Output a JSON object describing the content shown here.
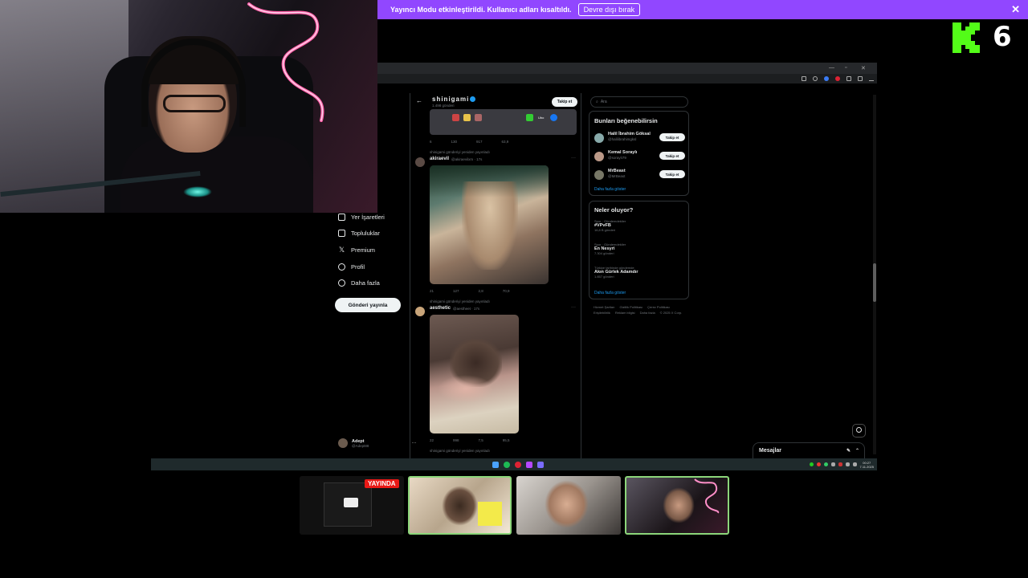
{
  "banner": {
    "message": "Yayıncı Modu etkinleştirildi. Kullanıcı adları kısaltıldı.",
    "button": "Devre dışı bırak",
    "close": "✕"
  },
  "kick": {
    "count": "6"
  },
  "left_nav": {
    "items": [
      {
        "label": "Yer İşaretleri",
        "icon": "bookmark-icon"
      },
      {
        "label": "Topluluklar",
        "icon": "communities-icon"
      },
      {
        "label": "Premium",
        "icon": "x-logo-icon"
      },
      {
        "label": "Profil",
        "icon": "profile-icon"
      },
      {
        "label": "Daha fazla",
        "icon": "more-icon"
      }
    ],
    "post_button": "Gönderi yayınla",
    "account_name": "Adept",
    "account_handle": "@Adept88"
  },
  "profile_header": {
    "name": "shinigami",
    "sub": "1.498 gönderi",
    "follow": "Takip et"
  },
  "feed": {
    "posts": [
      {
        "retweet_label": "shinigami gönderiyi yeniden yayınladı",
        "name": "akiraevil",
        "handle": "@akiraevilxm · 17s",
        "actions": [
          "21",
          "127",
          "2,8",
          "70,9"
        ]
      },
      {
        "retweet_label": "shinigami gönderiyi yeniden yayınladı",
        "name": "aesthetic",
        "handle": "@aestheet · 17s",
        "actions": [
          "22",
          "998",
          "7,5",
          "95,5"
        ]
      },
      {
        "retweet_label": "shinigami gönderiyi yeniden yayınladı",
        "name": "",
        "handle": "",
        "actions": []
      }
    ],
    "top_actions": [
      "6",
      "130",
      "917",
      "63,9"
    ],
    "strip_label": "Ubo"
  },
  "sidebar": {
    "search_placeholder": "Ara",
    "who_to_follow_title": "Bunları beğenebilirsin",
    "suggestions": [
      {
        "name": "Halil İbrahim Göksal",
        "handle": "@halilibrahimgksl",
        "button": "Takip et"
      },
      {
        "name": "Kemal Soraylı",
        "handle": "@soraylı79",
        "button": "Takip et"
      },
      {
        "name": "MrBeast",
        "handle": "@MrBeast",
        "button": "Takip et"
      }
    ],
    "show_more": "Daha fazla göster",
    "trends_title": "Neler oluyor?",
    "trends": [
      {
        "category": "Spor · Gündemdekiler",
        "name": "#VPvFB",
        "count": "16,8 B gönderi"
      },
      {
        "category": "Spor · Gündemdekiler",
        "name": "En Nesyri",
        "count": "7.304 gönderi"
      },
      {
        "category": "Türkiye tarihinde gündemde",
        "name": "Akın Gürlek Adamdır",
        "count": "1.857 gönderi"
      }
    ],
    "trends_show_more": "Daha fazla göster",
    "footer": [
      "Hizmet Şartları",
      "Gizlilik Politikası",
      "Çerez Politikası",
      "Erişilebilirlik",
      "Reklam bilgisi",
      "Daha fazla",
      "© 2025 X Corp."
    ]
  },
  "messages": {
    "label": "Mesajlar"
  },
  "taskbar": {
    "time": "00:27",
    "date": "7.11.2025"
  },
  "thumbnails": {
    "live_badge": "YAYINDA"
  },
  "colors": {
    "banner": "#9147ff",
    "kick_green": "#53fc18",
    "link_blue": "#1d9bf0",
    "live_red": "#e91916",
    "thumb_border": "#8cd67a"
  }
}
